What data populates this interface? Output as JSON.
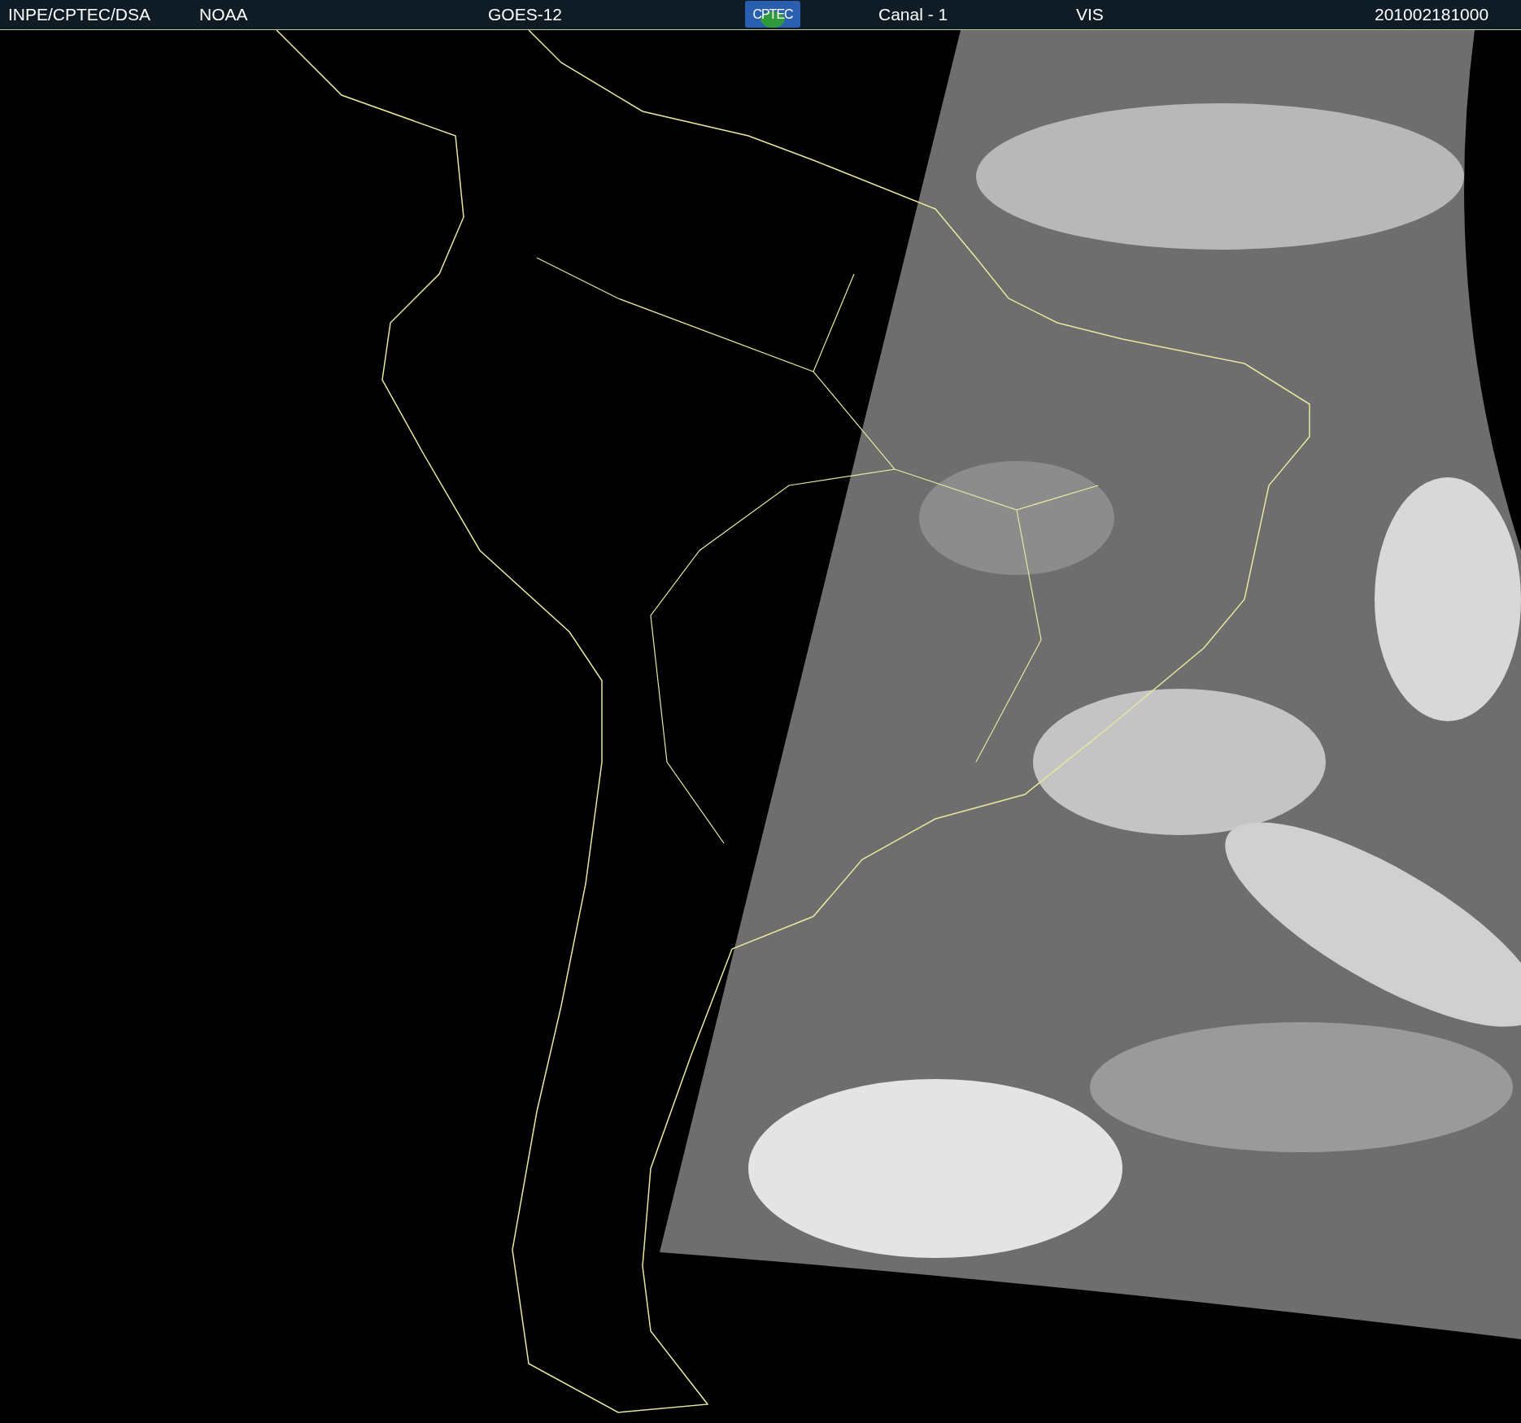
{
  "header": {
    "items": [
      {
        "kind": "text",
        "text": "INPE/CPTEC/DSA"
      },
      {
        "kind": "text",
        "text": "NOAA"
      },
      {
        "kind": "text",
        "text": "GOES-12"
      },
      {
        "kind": "logo",
        "text": "CPTEC"
      },
      {
        "kind": "text",
        "text": "Canal - 1"
      },
      {
        "kind": "text",
        "text": "VIS"
      },
      {
        "kind": "text",
        "text": "201002181000"
      }
    ]
  }
}
